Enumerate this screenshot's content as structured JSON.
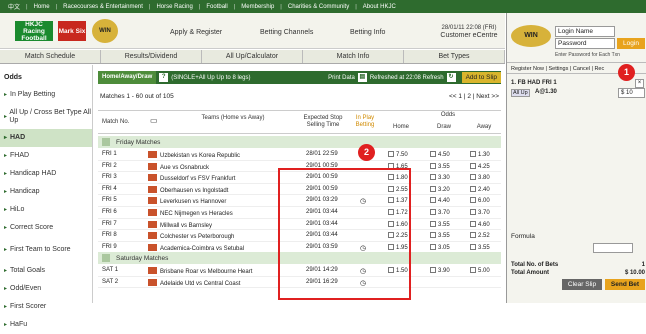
{
  "topbar": {
    "items": [
      "中文",
      "Home",
      "Racecourses & Entertainment",
      "Horse Racing",
      "Football",
      "Membership",
      "Charities & Community",
      "About HKJC"
    ]
  },
  "header": {
    "racing_logo": "HKJC Racing Football",
    "marksix_logo": "Mark Six",
    "bet_logo": "WIN",
    "links": [
      "Apply & Register",
      "Betting Channels",
      "Betting Info"
    ],
    "datetime": "28/01/11 22:08 (FRI)",
    "customer": "Customer eCentre"
  },
  "subnav": [
    "Match Schedule",
    "Results/Dividend",
    "All Up/Calculator",
    "Match Info",
    "Bet Types"
  ],
  "leftnav": {
    "title": "Odds",
    "items": [
      "In Play Betting",
      "All Up / Cross Bet Type All Up",
      "HAD",
      "FHAD",
      "Handicap HAD",
      "Handicap",
      "HiLo",
      "Correct Score",
      "First Team to Score",
      "Total Goals",
      "Odd/Even",
      "First Scorer",
      "HaFu"
    ]
  },
  "oddsbar": {
    "tab": "Home/Away/Draw",
    "note": "(SINGLE+All Up Up to 8 legs)",
    "print": "Print Data",
    "refreshed": "Refreshed at 22:08 Refresh",
    "add": "Add to Slip"
  },
  "matchinfo": "Matches 1 - 60 out of 105",
  "pager": "<< 1 | 2 | Next >>",
  "columns": {
    "match_no": "Match No.",
    "teams": "Teams (Home vs Away)",
    "stop": "Expected Stop Selling Time",
    "inplay": "In Play Betting",
    "odds": "Odds",
    "home": "Home",
    "draw": "Draw",
    "away": "Away"
  },
  "groups": {
    "friday": "Friday Matches",
    "saturday": "Saturday Matches"
  },
  "rows": [
    {
      "no": "FRI 1",
      "teams": "Uzbekistan vs Korea Republic",
      "time": "28/01 22:59",
      "inplay": true,
      "home": "7.50",
      "draw": "4.50",
      "away": "1.30"
    },
    {
      "no": "FRI 2",
      "teams": "Aue vs Osnabruck",
      "time": "29/01 00:59",
      "inplay": false,
      "home": "1.65",
      "draw": "3.55",
      "away": "4.25"
    },
    {
      "no": "FRI 3",
      "teams": "Dusseldorf vs FSV Frankfurt",
      "time": "29/01 00:59",
      "inplay": false,
      "home": "1.80",
      "draw": "3.30",
      "away": "3.80"
    },
    {
      "no": "FRI 4",
      "teams": "Oberhausen vs Ingolstadt",
      "time": "29/01 00:59",
      "inplay": false,
      "home": "2.55",
      "draw": "3.20",
      "away": "2.40"
    },
    {
      "no": "FRI 5",
      "teams": "Leverkusen vs Hannover",
      "time": "29/01 03:29",
      "inplay": true,
      "home": "1.37",
      "draw": "4.40",
      "away": "6.00"
    },
    {
      "no": "FRI 6",
      "teams": "NEC Nijmegen vs Heracles",
      "time": "29/01 03:44",
      "inplay": false,
      "home": "1.72",
      "draw": "3.70",
      "away": "3.70"
    },
    {
      "no": "FRI 7",
      "teams": "Millwall vs Barnsley",
      "time": "29/01 03:44",
      "inplay": false,
      "home": "1.60",
      "draw": "3.55",
      "away": "4.60"
    },
    {
      "no": "FRI 8",
      "teams": "Colchester vs Peterborough",
      "time": "29/01 03:44",
      "inplay": false,
      "home": "2.25",
      "draw": "3.55",
      "away": "2.52"
    },
    {
      "no": "FRI 9",
      "teams": "Academica-Coimbra vs Setubal",
      "time": "29/01 03:59",
      "inplay": true,
      "home": "1.95",
      "draw": "3.05",
      "away": "3.55"
    }
  ],
  "sat_rows": [
    {
      "no": "SAT 1",
      "teams": "Brisbane Roar vs Melbourne Heart",
      "time": "29/01 14:29",
      "inplay": true,
      "home": "1.50",
      "draw": "3.90",
      "away": "5.00"
    },
    {
      "no": "SAT 2",
      "teams": "Adelaide Utd vs Central Coast",
      "time": "29/01 16:29",
      "inplay": true,
      "home": "",
      "draw": "",
      "away": ""
    }
  ],
  "badges": {
    "one": "1",
    "two": "2"
  },
  "rightpanel": {
    "login_name": "Login Name",
    "password": "Password",
    "login": "Login",
    "remember": "Enter Password for Each Txn",
    "links": "Register Now | Settings | Cancel | Rec",
    "bet_title": "1. FB HAD FRI 1",
    "allup": "All Up",
    "selection": "A@1.30",
    "stake": "$ 10",
    "formula": "Formula",
    "total_bets_label": "Total No. of Bets",
    "total_bets": "1",
    "total_amount_label": "Total Amount",
    "total_amount": "$ 10.00",
    "clear": "Clear Slip",
    "send": "Send Bet"
  }
}
